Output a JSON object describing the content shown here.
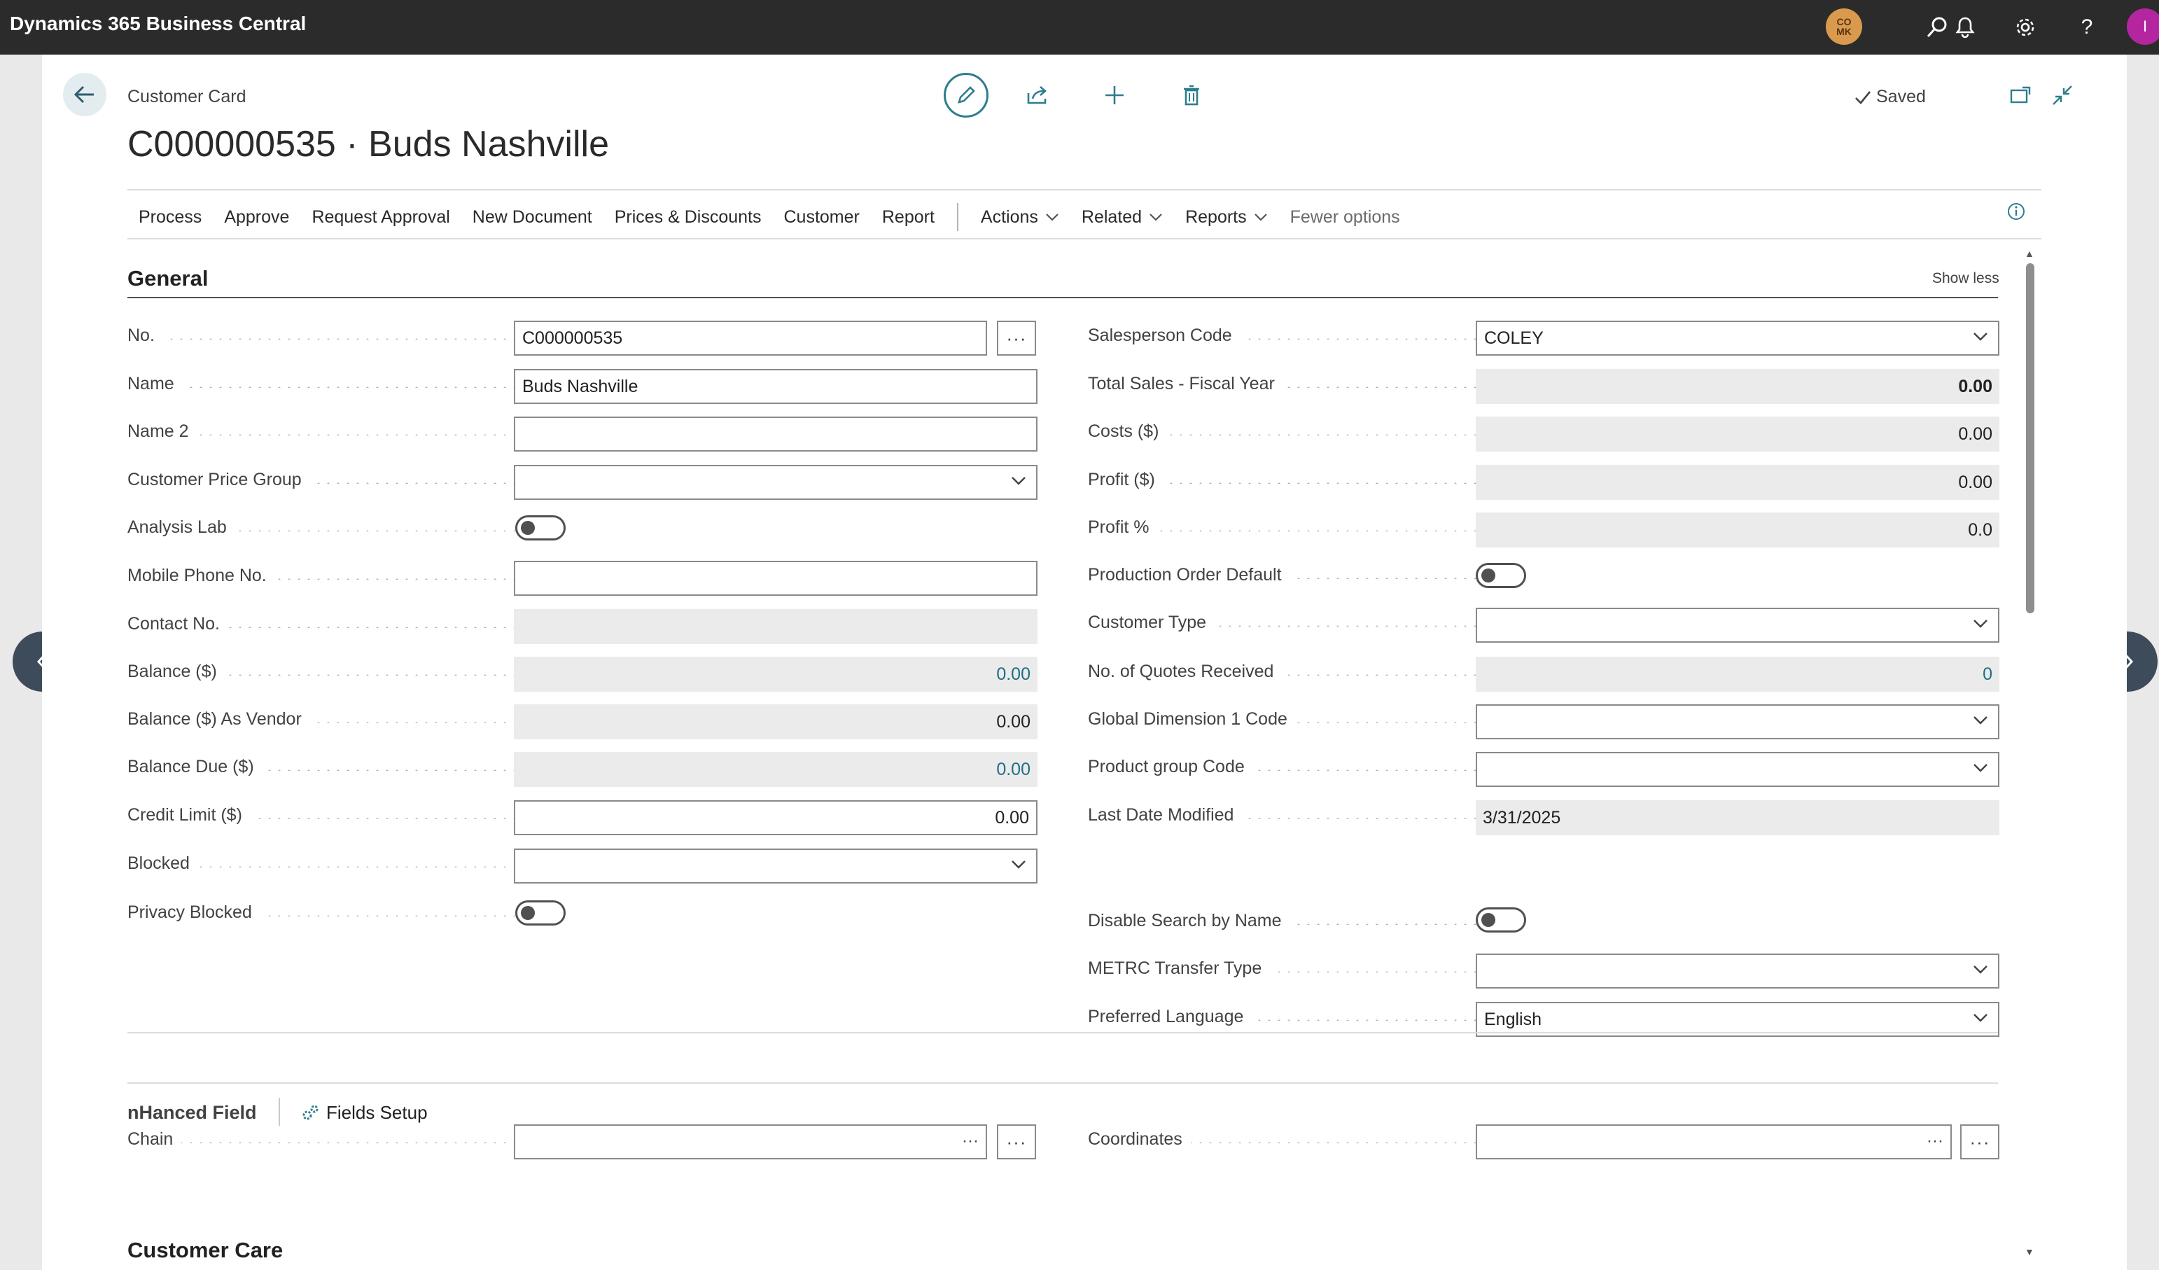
{
  "app": {
    "title": "Dynamics 365 Business Central",
    "company_badge": "CO\nMK",
    "user_initial": "I"
  },
  "header": {
    "breadcrumb": "Customer Card",
    "title": "C000000535 · Buds Nashville",
    "saved_label": "Saved"
  },
  "actionbar": {
    "items": [
      "Process",
      "Approve",
      "Request Approval",
      "New Document",
      "Prices & Discounts",
      "Customer",
      "Report"
    ],
    "menus": [
      "Actions",
      "Related",
      "Reports"
    ],
    "fewer_options": "Fewer options"
  },
  "general": {
    "title": "General",
    "show_less": "Show less",
    "left": [
      {
        "label": "No.",
        "value": "C000000535"
      },
      {
        "label": "Name",
        "value": "Buds Nashville"
      },
      {
        "label": "Name 2",
        "value": ""
      },
      {
        "label": "Customer Price Group",
        "value": ""
      },
      {
        "label": "Analysis Lab",
        "value": "off"
      },
      {
        "label": "Mobile Phone No.",
        "value": ""
      },
      {
        "label": "Contact No.",
        "value": ""
      },
      {
        "label": "Balance ($)",
        "value": "0.00"
      },
      {
        "label": "Balance ($) As Vendor",
        "value": "0.00"
      },
      {
        "label": "Balance Due ($)",
        "value": "0.00"
      },
      {
        "label": "Credit Limit ($)",
        "value": "0.00"
      },
      {
        "label": "Blocked",
        "value": ""
      },
      {
        "label": "Privacy Blocked",
        "value": "off"
      }
    ],
    "right": [
      {
        "label": "Salesperson Code",
        "value": "COLEY"
      },
      {
        "label": "Total Sales - Fiscal Year",
        "value": "0.00"
      },
      {
        "label": "Costs ($)",
        "value": "0.00"
      },
      {
        "label": "Profit ($)",
        "value": "0.00"
      },
      {
        "label": "Profit %",
        "value": "0.0"
      },
      {
        "label": "Production Order Default",
        "value": "off"
      },
      {
        "label": "Customer Type",
        "value": ""
      },
      {
        "label": "No. of Quotes Received",
        "value": "0"
      },
      {
        "label": "Global Dimension 1 Code",
        "value": ""
      },
      {
        "label": "Product group Code",
        "value": ""
      },
      {
        "label": "Last Date Modified",
        "value": "3/31/2025"
      },
      {
        "label": "Disable Search by Name",
        "value": "off"
      },
      {
        "label": "METRC Transfer Type",
        "value": ""
      },
      {
        "label": "Preferred Language",
        "value": "English"
      }
    ]
  },
  "nhanced": {
    "title": "nHanced Field",
    "fields_setup": "Fields Setup",
    "chain_label": "Chain",
    "chain_value": "",
    "coordinates_label": "Coordinates",
    "coordinates_value": ""
  },
  "customer_care": {
    "title": "Customer Care"
  },
  "icons": {
    "back": "arrow-left-icon",
    "edit": "pencil-icon",
    "share": "share-icon",
    "new": "plus-icon",
    "delete": "trash-icon",
    "open_new_window": "open-new-window-icon",
    "collapse": "collapse-icon",
    "info": "info-icon",
    "search": "search-icon",
    "bell": "bell-icon",
    "settings": "gear-icon",
    "help": "help-icon"
  },
  "colors": {
    "topbar": "#2b2b2b",
    "accent": "#2e7d8c",
    "link_value": "#1f6f84",
    "avatar": "#b4269f",
    "company_badge": "#d99a4e"
  }
}
